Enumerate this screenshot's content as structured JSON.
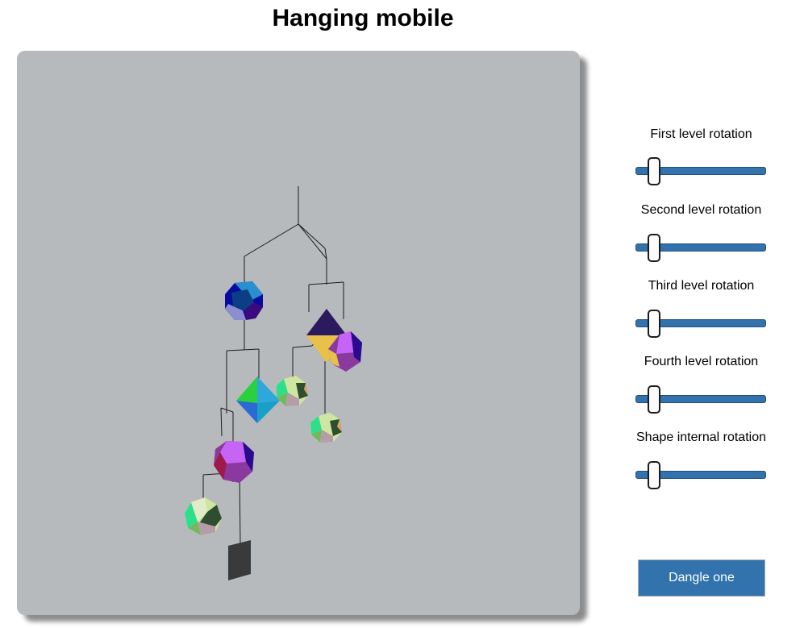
{
  "page": {
    "title": "Hanging mobile"
  },
  "controls": {
    "sliders": [
      {
        "label": "First level rotation",
        "value": 0.14
      },
      {
        "label": "Second level rotation",
        "value": 0.14
      },
      {
        "label": "Third level rotation",
        "value": 0.14
      },
      {
        "label": "Fourth level rotation",
        "value": 0.14
      },
      {
        "label": "Shape internal rotation",
        "value": 0.14
      }
    ],
    "dangle_button": "Dangle one"
  },
  "colors": {
    "scene_background": "#b7babd",
    "slider_track": "#3273ae",
    "button_background": "#3273ae",
    "string": "#1a1a1a"
  },
  "scene": {
    "shapes": [
      {
        "name": "dodecahedron",
        "colors": [
          "#0a0a9e",
          "#0a3f86",
          "#2a8fcf",
          "#8b8fcf",
          "#3a0a7e"
        ]
      },
      {
        "name": "octahedron",
        "colors": [
          "#2b1a5e",
          "#e8c04a"
        ]
      },
      {
        "name": "dodecahedron",
        "colors": [
          "#c664f5",
          "#2a0a8e",
          "#8a3a9e",
          "#e8c04a"
        ]
      },
      {
        "name": "octahedron",
        "colors": [
          "#2ea7dc",
          "#19a0c8",
          "#2ad13e",
          "#2a6ad1"
        ]
      },
      {
        "name": "icosahedron",
        "colors": [
          "#cfe6a2",
          "#2f4e2f",
          "#2ddf8a",
          "#d6a95e",
          "#b59ca8"
        ]
      },
      {
        "name": "icosahedron",
        "colors": [
          "#cfe6a2",
          "#2f4e2f",
          "#2ddf8a",
          "#d6a95e",
          "#b59ca8"
        ]
      },
      {
        "name": "dodecahedron",
        "colors": [
          "#c664f5",
          "#2a0a8e",
          "#8a3a9e",
          "#9e1a4a"
        ]
      },
      {
        "name": "icosahedron",
        "colors": [
          "#cfe6a2",
          "#2f4e2f",
          "#2ddf8a",
          "#d6a95e",
          "#b59ca8"
        ]
      },
      {
        "name": "cube",
        "colors": [
          "#3a3a3a"
        ]
      }
    ]
  }
}
